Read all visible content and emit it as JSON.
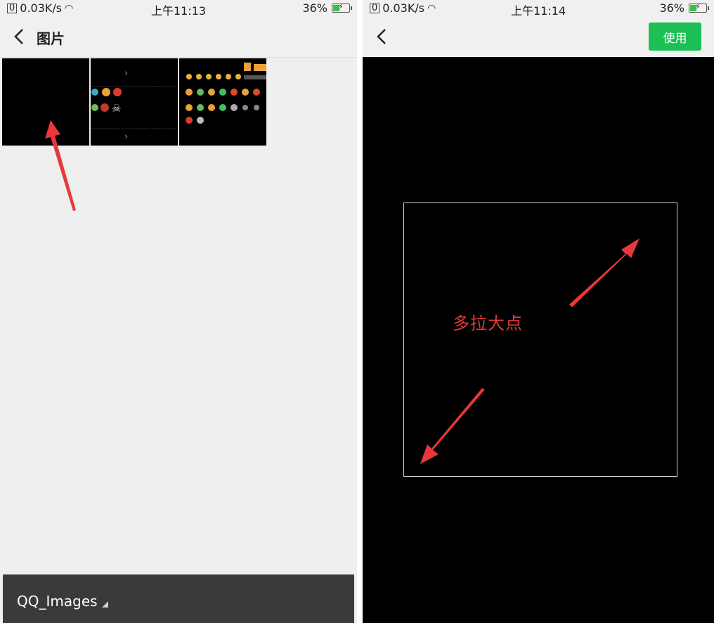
{
  "left_screen": {
    "status": {
      "network_speed": "0.03K/s",
      "time": "上午11:13",
      "battery": "36%",
      "battery_level": 0.36
    },
    "nav": {
      "title": "图片"
    },
    "thumbnails": [
      "black-image",
      "sticker-sheet-partial",
      "sticker-sheet-full"
    ],
    "bottom_bar": {
      "folder_name": "QQ_Images"
    }
  },
  "right_screen": {
    "status": {
      "network_speed": "0.03K/s",
      "time": "上午11:14",
      "battery": "36%",
      "battery_level": 0.36
    },
    "nav": {
      "use_button": "使用"
    },
    "annotation": "多拉大点"
  },
  "colors": {
    "accent_green": "#1bbf55",
    "annotation_red": "#e8383a",
    "bottom_bar": "#3a3a3a"
  }
}
